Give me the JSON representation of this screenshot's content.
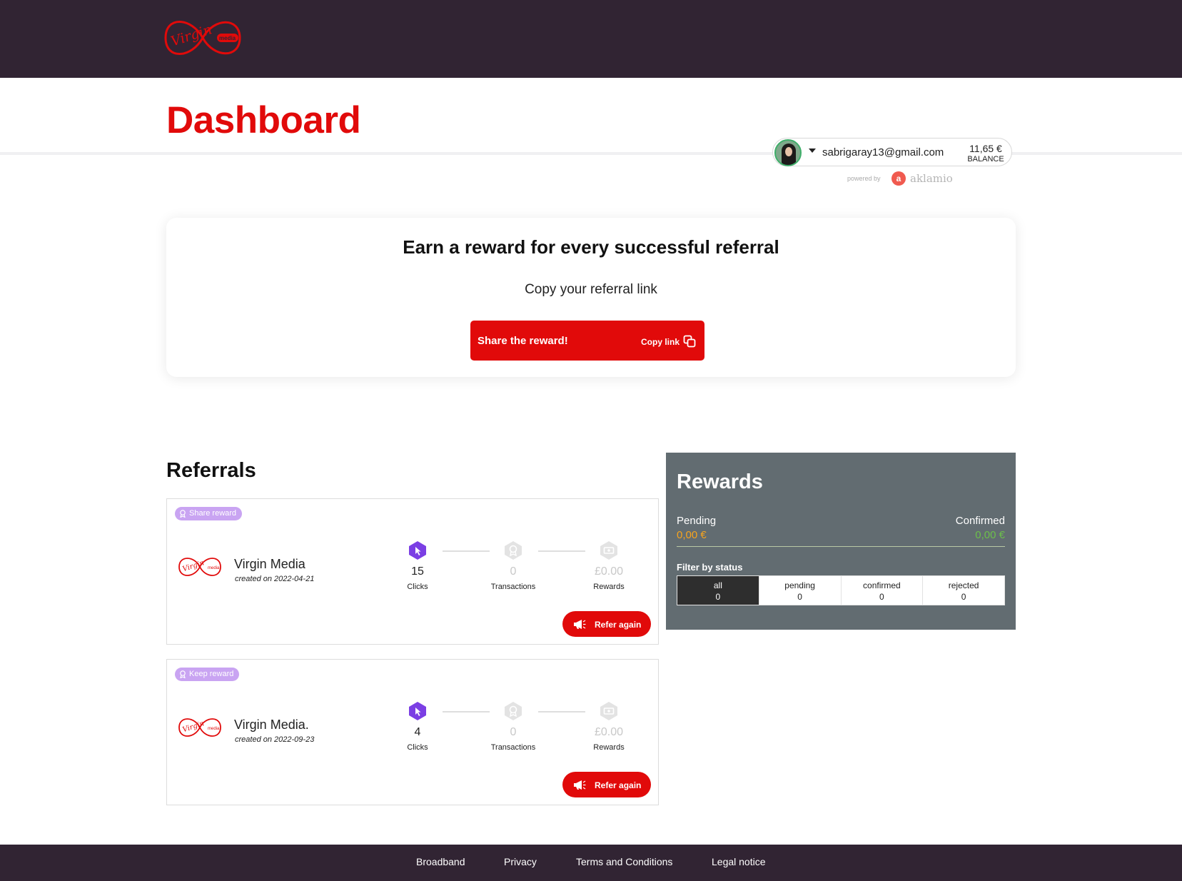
{
  "header": {
    "brand": "Virgin media"
  },
  "page": {
    "title": "Dashboard"
  },
  "account": {
    "email": "sabrigaray13@gmail.com",
    "balance_amount": "11,65 €",
    "balance_label": "BALANCE",
    "powered_by_label": "powered by",
    "powered_by_brand": "aklamio"
  },
  "share_card": {
    "title": "Earn a reward for every successful referral",
    "subtitle": "Copy your referral link",
    "button_label": "Share the reward!",
    "copy_label": "Copy link"
  },
  "referrals": {
    "title": "Referrals",
    "stage_labels": [
      "Clicks",
      "Transactions",
      "Rewards"
    ],
    "refer_again_label": "Refer again",
    "items": [
      {
        "badge": "Share reward",
        "merchant": "Virgin Media",
        "created": "created on 2022-04-21",
        "clicks": "15",
        "transactions": "0",
        "rewards": "£0.00"
      },
      {
        "badge": "Keep reward",
        "merchant": "Virgin Media.",
        "created": "created on 2022-09-23",
        "clicks": "4",
        "transactions": "0",
        "rewards": "£0.00"
      }
    ]
  },
  "rewards": {
    "title": "Rewards",
    "pending_label": "Pending",
    "pending_value": "0,00 €",
    "confirmed_label": "Confirmed",
    "confirmed_value": "0,00 €",
    "filter_label": "Filter by status",
    "filters": [
      {
        "label": "all",
        "count": "0",
        "active": true
      },
      {
        "label": "pending",
        "count": "0",
        "active": false
      },
      {
        "label": "confirmed",
        "count": "0",
        "active": false
      },
      {
        "label": "rejected",
        "count": "0",
        "active": false
      }
    ]
  },
  "footer": {
    "links": [
      "Broadband",
      "Privacy",
      "Terms and Conditions",
      "Legal notice"
    ]
  },
  "colors": {
    "brand_red": "#e10a0a",
    "header_bg": "#312433",
    "panel_bg": "#626c71",
    "pending": "#f7a41d",
    "confirmed": "#6cc04a",
    "badge": "#c9a4f2",
    "click_stage": "#7b3fe4"
  }
}
